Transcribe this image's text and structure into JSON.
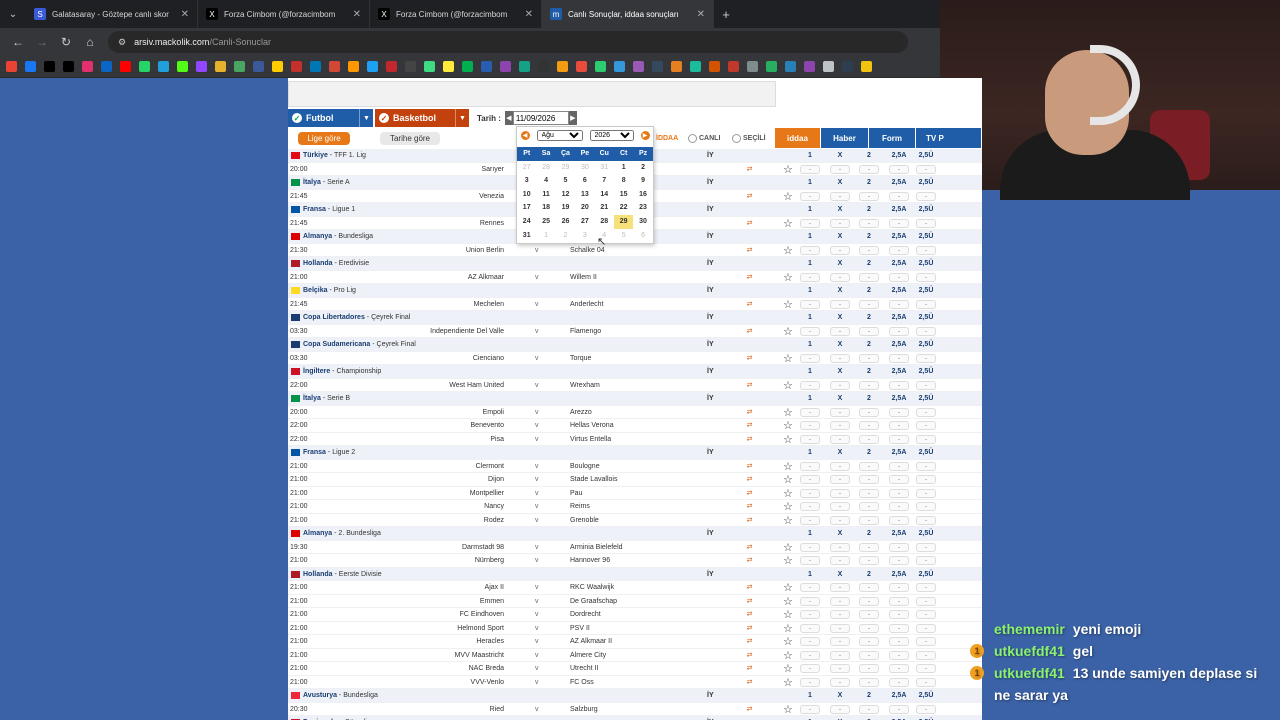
{
  "browser": {
    "tabs": [
      {
        "label": "Galatasaray - Göztepe canlı skor",
        "icon": "sofascore-icon"
      },
      {
        "label": "Forza Cimbom (@forzacimbom",
        "icon": "x-icon"
      },
      {
        "label": "Forza Cimbom (@forzacimbom",
        "icon": "x-icon"
      },
      {
        "label": "Canlı Sonuçlar, iddaa sonuçları",
        "icon": "mackolik-icon",
        "active": true
      }
    ],
    "url_host": "arsiv.mackolik.com",
    "url_path": "/Canli-Sonuclar"
  },
  "toolbar": {
    "futbol": "Futbol",
    "basketbol": "Basketbol",
    "tarih_label": "Tarih :",
    "date_value": "11/09/2026",
    "lige_gore": "Lige göre",
    "tarihe_gore": "Tarihe göre",
    "iddaa_tag": "İDDAA",
    "canli": "CANLI",
    "secili": "SEÇİLİ"
  },
  "headers": {
    "iddaa": "iddaa",
    "haber": "Haber",
    "form": "Form",
    "tv": "TV P"
  },
  "odds_header": {
    "one": "1",
    "x": "X",
    "two": "2",
    "a25": "2,5A",
    "u25": "2,5Ü"
  },
  "odd_placeholder": "-",
  "iy_label": "İY",
  "v_label": "v",
  "calendar": {
    "month": "Ağu",
    "year": "2026",
    "weekdays": [
      "Pt",
      "Sa",
      "Ça",
      "Pe",
      "Cu",
      "Ct",
      "Pz"
    ],
    "weeks": [
      [
        "27",
        "28",
        "29",
        "30",
        "31",
        "1",
        "2"
      ],
      [
        "3",
        "4",
        "5",
        "6",
        "7",
        "8",
        "9"
      ],
      [
        "10",
        "11",
        "12",
        "13",
        "14",
        "15",
        "16"
      ],
      [
        "17",
        "18",
        "19",
        "20",
        "21",
        "22",
        "23"
      ],
      [
        "24",
        "25",
        "26",
        "27",
        "28",
        "29",
        "30"
      ],
      [
        "31",
        "1",
        "2",
        "3",
        "4",
        "5",
        "6"
      ]
    ],
    "selected": "29"
  },
  "rows": [
    {
      "type": "league",
      "country": "Türkiye",
      "league": "TFF 1. Lig",
      "flag": "#e30a17"
    },
    {
      "type": "match",
      "time": "20:00",
      "home": "Sarıyer",
      "away": ""
    },
    {
      "type": "league",
      "country": "İtalya",
      "league": "Serie A",
      "flag": "#009246"
    },
    {
      "type": "match",
      "time": "21:45",
      "home": "Venezia",
      "away": ""
    },
    {
      "type": "league",
      "country": "Fransa",
      "league": "Ligue 1",
      "flag": "#0055a4"
    },
    {
      "type": "match",
      "time": "21:45",
      "home": "Rennes",
      "away": ""
    },
    {
      "type": "league",
      "country": "Almanya",
      "league": "Bundesliga",
      "flag": "#dd0000"
    },
    {
      "type": "match",
      "time": "21:30",
      "home": "Union Berlin",
      "away": "Schalke 04"
    },
    {
      "type": "league",
      "country": "Hollanda",
      "league": "Eredivisie",
      "flag": "#ae1c28"
    },
    {
      "type": "match",
      "time": "21:00",
      "home": "AZ Alkmaar",
      "away": "Willem II"
    },
    {
      "type": "league",
      "country": "Belçika",
      "league": "Pro Lig",
      "flag": "#fdda24"
    },
    {
      "type": "match",
      "time": "21:45",
      "home": "Mechelen",
      "away": "Anderlecht"
    },
    {
      "type": "league",
      "country": "Copa Libertadores",
      "league": "Çeyrek Final",
      "flag": "#1a3c70"
    },
    {
      "type": "match",
      "time": "03:30",
      "home": "Independiente Del Valle",
      "away": "Flamengo"
    },
    {
      "type": "league",
      "country": "Copa Sudamericana",
      "league": "Çeyrek Final",
      "flag": "#1a3c70"
    },
    {
      "type": "match",
      "time": "03:30",
      "home": "Cienciano",
      "away": "Torque"
    },
    {
      "type": "league",
      "country": "İngiltere",
      "league": "Championship",
      "flag": "#ce1124"
    },
    {
      "type": "match",
      "time": "22:00",
      "home": "West Ham United",
      "away": "Wrexham"
    },
    {
      "type": "league",
      "country": "İtalya",
      "league": "Serie B",
      "flag": "#009246"
    },
    {
      "type": "match",
      "time": "20:00",
      "home": "Empoli",
      "away": "Arezzo"
    },
    {
      "type": "match",
      "time": "22:00",
      "home": "Benevento",
      "away": "Hellas Verona"
    },
    {
      "type": "match",
      "time": "22:00",
      "home": "Pisa",
      "away": "Virtus Entella"
    },
    {
      "type": "league",
      "country": "Fransa",
      "league": "Ligue 2",
      "flag": "#0055a4"
    },
    {
      "type": "match",
      "time": "21:00",
      "home": "Clermont",
      "away": "Boulogne"
    },
    {
      "type": "match",
      "time": "21:00",
      "home": "Dijon",
      "away": "Stade Lavallois"
    },
    {
      "type": "match",
      "time": "21:00",
      "home": "Montpellier",
      "away": "Pau"
    },
    {
      "type": "match",
      "time": "21:00",
      "home": "Nancy",
      "away": "Reims"
    },
    {
      "type": "match",
      "time": "21:00",
      "home": "Rodez",
      "away": "Grenoble"
    },
    {
      "type": "league",
      "country": "Almanya",
      "league": "2. Bundesliga",
      "flag": "#dd0000"
    },
    {
      "type": "match",
      "time": "19:30",
      "home": "Darmstadt 98",
      "away": "Arminia Bielefeld"
    },
    {
      "type": "match",
      "time": "21:00",
      "home": "Nürnberg",
      "away": "Hannover 96"
    },
    {
      "type": "league",
      "country": "Hollanda",
      "league": "Eerste Divisie",
      "flag": "#ae1c28"
    },
    {
      "type": "match",
      "time": "21:00",
      "home": "Ajax II",
      "away": "RKC Waalwijk"
    },
    {
      "type": "match",
      "time": "21:00",
      "home": "Emmen",
      "away": "De Graafschap"
    },
    {
      "type": "match",
      "time": "21:00",
      "home": "FC Eindhoven",
      "away": "Dordrecht"
    },
    {
      "type": "match",
      "time": "21:00",
      "home": "Helmond Sport",
      "away": "PSV II"
    },
    {
      "type": "match",
      "time": "21:00",
      "home": "Heracles",
      "away": "AZ Alkmaar II"
    },
    {
      "type": "match",
      "time": "21:00",
      "home": "MVV Maastricht",
      "away": "Almere City"
    },
    {
      "type": "match",
      "time": "21:00",
      "home": "NAC Breda",
      "away": "Utrecht II"
    },
    {
      "type": "match",
      "time": "21:00",
      "home": "VVV-Venlo",
      "away": "FC Oss"
    },
    {
      "type": "league",
      "country": "Avusturya",
      "league": "Bundesliga",
      "flag": "#ed2939"
    },
    {
      "type": "match",
      "time": "20:30",
      "home": "Ried",
      "away": "Salzburg"
    },
    {
      "type": "league",
      "country": "Danimarka",
      "league": "Süperlig",
      "flag": "#c8102e"
    }
  ],
  "chat": [
    {
      "user": "ethememir",
      "text": "yeni emoji",
      "badge": ""
    },
    {
      "user": "utkuefdf41",
      "text": "gel",
      "badge": "1"
    },
    {
      "user": "utkuefdf41",
      "text": "13 unde samiyen deplase si ne sarar ya",
      "badge": "1"
    }
  ]
}
